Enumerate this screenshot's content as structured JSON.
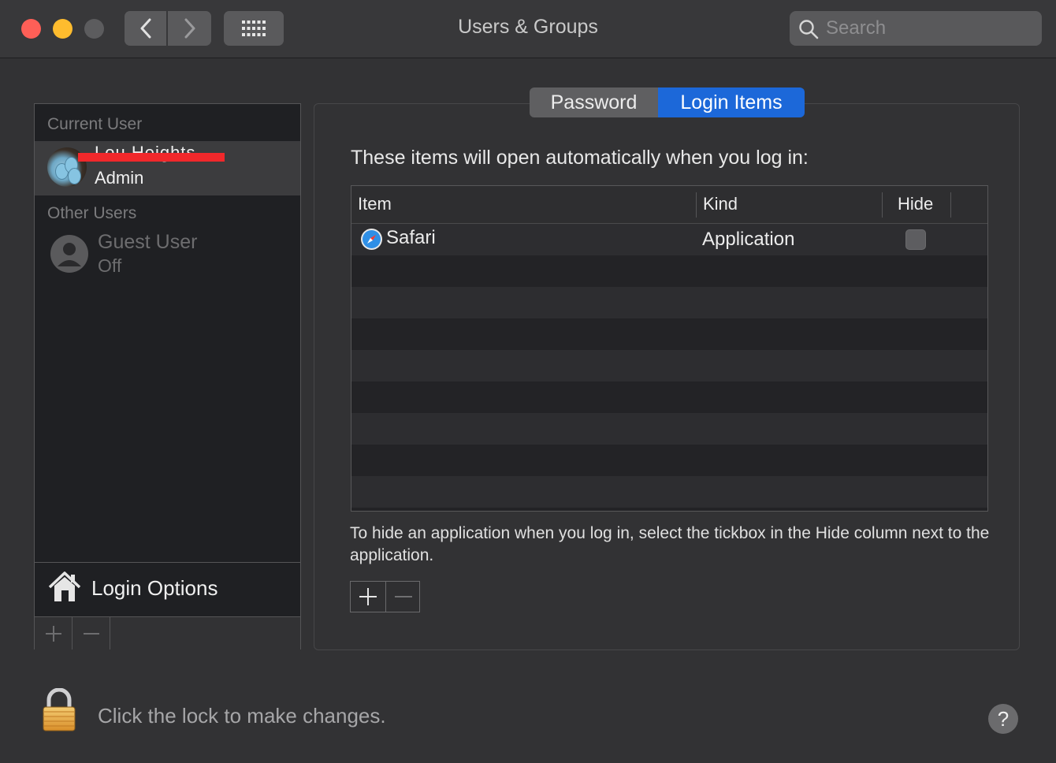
{
  "window": {
    "title": "Users & Groups"
  },
  "search": {
    "placeholder": "Search"
  },
  "sidebar": {
    "current_user_header": "Current User",
    "current_user": {
      "name": "Lou Heights",
      "role": "Admin"
    },
    "other_users_header": "Other Users",
    "other_users": [
      {
        "name": "Guest User",
        "status": "Off"
      }
    ],
    "login_options": "Login Options"
  },
  "tabs": [
    {
      "label": "Password",
      "selected": false
    },
    {
      "label": "Login Items",
      "selected": true
    }
  ],
  "login_items": {
    "description": "These items will open automatically when you log in:",
    "columns": [
      "Item",
      "Kind",
      "Hide"
    ],
    "rows": [
      {
        "item": "Safari",
        "kind": "Application",
        "hide": false
      }
    ],
    "hint": "To hide an application when you log in, select the tickbox in the Hide column next to the application."
  },
  "footer": {
    "lock_text": "Click the lock to make changes.",
    "help_label": "?"
  },
  "colors": {
    "accent": "#1c68d9",
    "window_bg": "#323234",
    "close": "#fe5f57",
    "minimize": "#febc2e"
  }
}
